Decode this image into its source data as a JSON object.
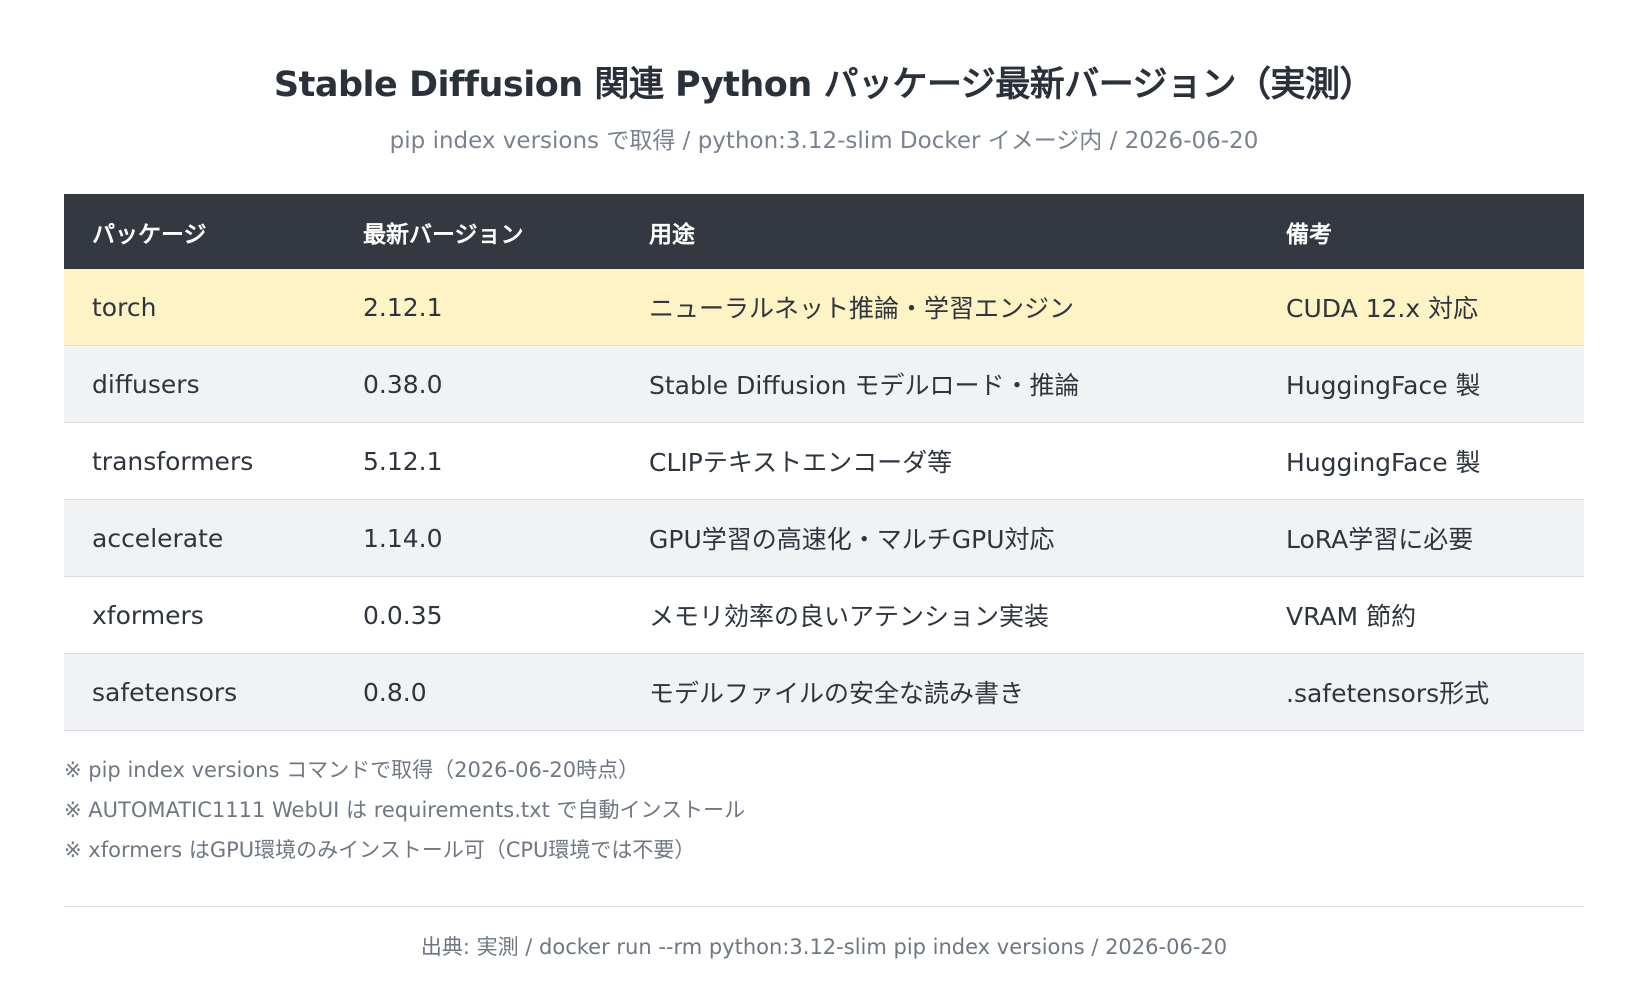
{
  "header": {
    "title": "Stable Diffusion 関連 Python パッケージ最新バージョン（実測）",
    "subtitle": "pip index versions で取得 / python:3.12-slim Docker イメージ内 / 2026-06-20"
  },
  "table": {
    "columns": [
      "パッケージ",
      "最新バージョン",
      "用途",
      "備考"
    ],
    "rows": [
      {
        "package": "torch",
        "version": "2.12.1",
        "purpose": "ニューラルネット推論・学習エンジン",
        "note": "CUDA 12.x 対応",
        "highlight": true
      },
      {
        "package": "diffusers",
        "version": "0.38.0",
        "purpose": "Stable Diffusion モデルロード・推論",
        "note": "HuggingFace 製",
        "highlight": false
      },
      {
        "package": "transformers",
        "version": "5.12.1",
        "purpose": "CLIPテキストエンコーダ等",
        "note": "HuggingFace 製",
        "highlight": false
      },
      {
        "package": "accelerate",
        "version": "1.14.0",
        "purpose": "GPU学習の高速化・マルチGPU対応",
        "note": "LoRA学習に必要",
        "highlight": false
      },
      {
        "package": "xformers",
        "version": "0.0.35",
        "purpose": "メモリ効率の良いアテンション実装",
        "note": "VRAM 節約",
        "highlight": false
      },
      {
        "package": "safetensors",
        "version": "0.8.0",
        "purpose": "モデルファイルの安全な読み書き",
        "note": ".safetensors形式",
        "highlight": false
      }
    ],
    "highlight_color": "#fdf3c4",
    "header_color": "#343840",
    "stripe_color": "#f1f2f4"
  },
  "notes": [
    "※ pip index versions コマンドで取得（2026-06-20時点）",
    "※ AUTOMATIC1111 WebUI は requirements.txt で自動インストール",
    "※ xformers はGPU環境のみインストール可（CPU環境では不要）"
  ],
  "footer": {
    "source": "出典: 実測 / docker run --rm python:3.12-slim pip index versions / 2026-06-20"
  }
}
